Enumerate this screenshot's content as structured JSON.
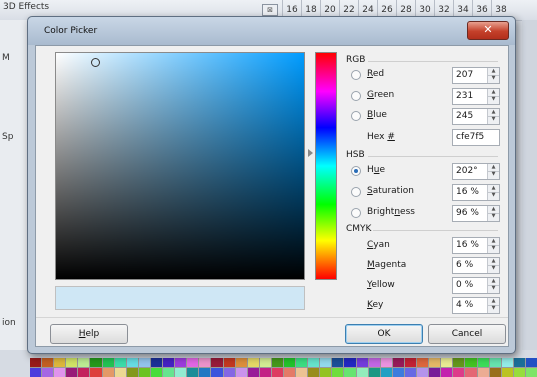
{
  "background": {
    "title": "3D Effects",
    "ruler": [
      "16",
      "18",
      "20",
      "22",
      "24",
      "26",
      "28",
      "30",
      "32",
      "34",
      "36",
      "38"
    ],
    "side_labels": [
      "M",
      "Sp",
      "ion"
    ]
  },
  "dialog": {
    "title": "Color Picker",
    "close_glyph": "✕",
    "rgb": {
      "label": "RGB",
      "red": {
        "label_u": "R",
        "label_rest": "ed",
        "value": "207"
      },
      "green": {
        "label_u": "G",
        "label_rest": "reen",
        "value": "231"
      },
      "blue": {
        "label_u": "B",
        "label_rest": "lue",
        "value": "245"
      },
      "hex": {
        "label": "Hex ",
        "label_u": "#",
        "value": "cfe7f5"
      }
    },
    "hsb": {
      "label": "HSB",
      "hue": {
        "label_a": "H",
        "label_u": "u",
        "label_b": "e",
        "value": "202°"
      },
      "saturation": {
        "label_u": "S",
        "label_rest": "aturation",
        "value": "16 %"
      },
      "brightness": {
        "label_a": "Bright",
        "label_u": "n",
        "label_b": "ess",
        "value": "96 %"
      }
    },
    "cmyk": {
      "label": "CMYK",
      "cyan": {
        "label_u": "C",
        "label_rest": "yan",
        "value": "16 %"
      },
      "magenta": {
        "label_u": "M",
        "label_rest": "agenta",
        "value": "6 %"
      },
      "yellow": {
        "label_u": "Y",
        "label_rest": "ellow",
        "value": "0 %"
      },
      "key": {
        "label_u": "K",
        "label_rest": "ey",
        "value": "4 %"
      }
    },
    "buttons": {
      "help_u": "H",
      "help_rest": "elp",
      "ok": "OK",
      "cancel": "Cancel"
    },
    "selected_color": "#cfe7f5",
    "hue_color": "#009cff"
  },
  "colors": {
    "dialog_frame": "#bcc9d8",
    "close_button": "#c4402a",
    "radio_checked": "#2a6db8"
  }
}
